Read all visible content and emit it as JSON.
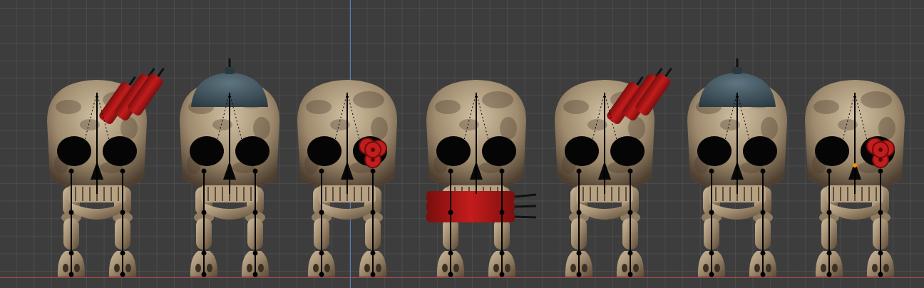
{
  "viewport": {
    "grid_color": "#4a4a4a",
    "background_color": "#3d3d3d",
    "axis_x_color": "#c24a4a",
    "axis_y_color": "#5a83c9"
  },
  "colors": {
    "bone_light": "#c9b79c",
    "bone_dark": "#6b5a45",
    "eye_socket": "#050505",
    "dynamite": "#b21818",
    "dynamite_dark": "#6e0d0d",
    "bomb_dome": "#3f5560",
    "armature": "#000000"
  },
  "characters": [
    {
      "id": "skull-1",
      "accessory": "dynamite-on-head"
    },
    {
      "id": "skull-2",
      "accessory": "bomb-helmet"
    },
    {
      "id": "skull-3",
      "accessory": "dynamite-eye"
    },
    {
      "id": "skull-4",
      "accessory": "dynamite-in-mouth"
    },
    {
      "id": "skull-5",
      "accessory": "dynamite-on-head"
    },
    {
      "id": "skull-6",
      "accessory": "bomb-helmet"
    },
    {
      "id": "skull-7",
      "accessory": "dynamite-eye"
    }
  ]
}
